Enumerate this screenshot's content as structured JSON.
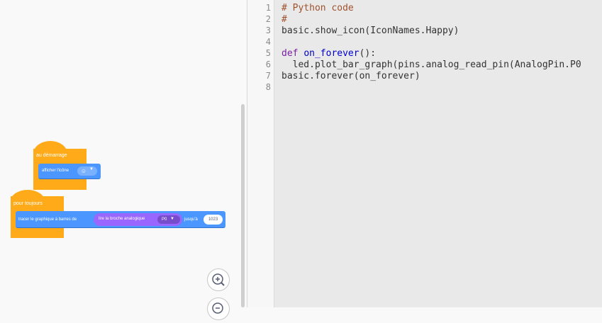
{
  "workspace": {
    "start_block": {
      "label": "au démarrage",
      "statement": "afficher l'icône",
      "icon_value": ":)"
    },
    "forever_block": {
      "label": "pour toujours",
      "statement": "tracer le graphique à barres de",
      "reporter": "lire la broche analogique",
      "pin_value": "P0",
      "upto_label": "jusqu'à",
      "upto_value": "1023"
    },
    "zoom_in_icon": "zoom-in-icon",
    "zoom_out_icon": "zoom-out-icon"
  },
  "editor": {
    "line_numbers": [
      "1",
      "2",
      "3",
      "4",
      "5",
      "6",
      "7",
      "8"
    ],
    "lines": [
      "# Python code",
      "#",
      "basic.show_icon(IconNames.Happy)",
      "",
      "def on_forever():",
      "  led.plot_bar_graph(pins.analog_read_pin(AnalogPin.P0",
      "basic.forever(on_forever)",
      ""
    ]
  },
  "colors": {
    "event_block": "#ffab19",
    "basic_block": "#4c97ff",
    "pins_block": "#9966ff",
    "comment": "#a0522d",
    "keyword": "#7a1fa2"
  }
}
